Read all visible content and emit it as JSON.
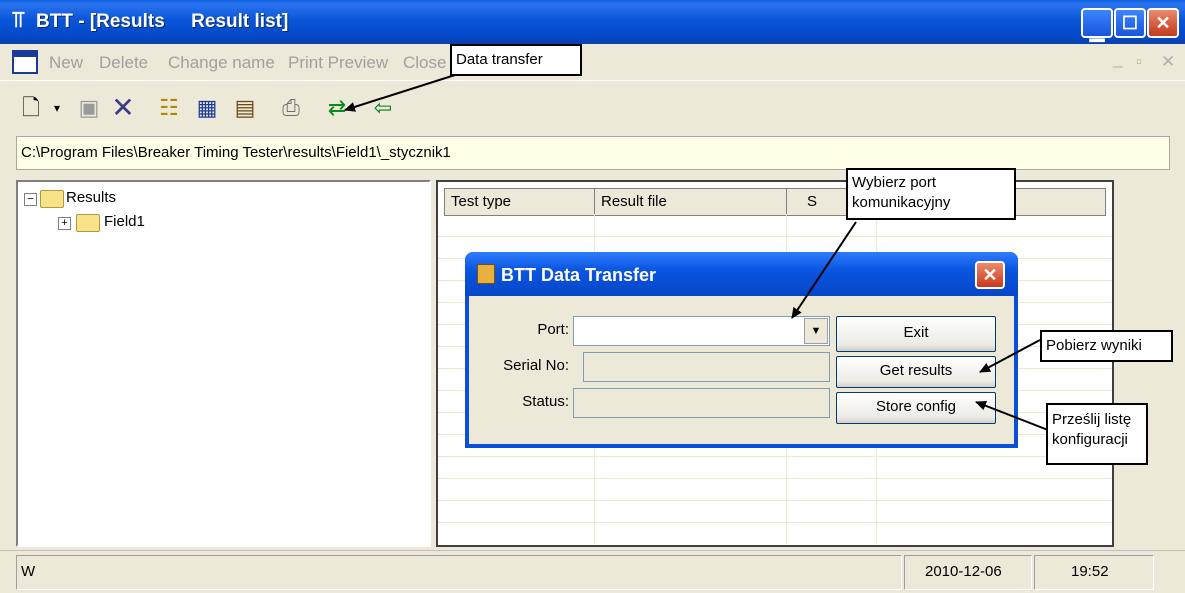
{
  "window": {
    "title": "BTT - [Results     Result list]",
    "title_icon": "btt-app-icon",
    "caption_buttons": [
      "minimize",
      "maximize",
      "close"
    ]
  },
  "menu": {
    "items": [
      "New",
      "Delete",
      "Change name",
      "Print Preview",
      "Close"
    ],
    "mdi_controls": [
      "_",
      "▫",
      "✕"
    ]
  },
  "toolbar": {
    "buttons": [
      "new-icon",
      "dropdown-icon",
      "disk-icon",
      "delete-icon",
      "tree-icon",
      "calendar-icon",
      "report-icon",
      "print-icon",
      "data-transfer-icon",
      "exit-icon"
    ]
  },
  "path": "C:\\Program Files\\Breaker Timing Tester\\results\\Field1\\_stycznik1",
  "tree": {
    "root": "Results",
    "children": [
      "Field1"
    ]
  },
  "grid": {
    "columns": [
      "Test type",
      "Result file",
      "S"
    ]
  },
  "status": {
    "left": "W",
    "date": "2010-12-06",
    "time": "19:52"
  },
  "dialog": {
    "title": "BTT Data Transfer",
    "port_label": "Port:",
    "port_value": "",
    "serial_label": "Serial No:",
    "serial_value": "",
    "status_label": "Status:",
    "status_value": "",
    "exit": "Exit",
    "get_results": "Get results",
    "store_config": "Store config"
  },
  "annotations": {
    "data_transfer": "Data transfer",
    "port": "Wybierz port\nkomunikacyjny",
    "get_results": "Pobierz wyniki",
    "store_config": "Prześlij listę\nkonfiguracji"
  },
  "colors": {
    "xp_blue": "#0a56d8",
    "window_face": "#ece9d8",
    "path_bg": "#ffffe8"
  }
}
